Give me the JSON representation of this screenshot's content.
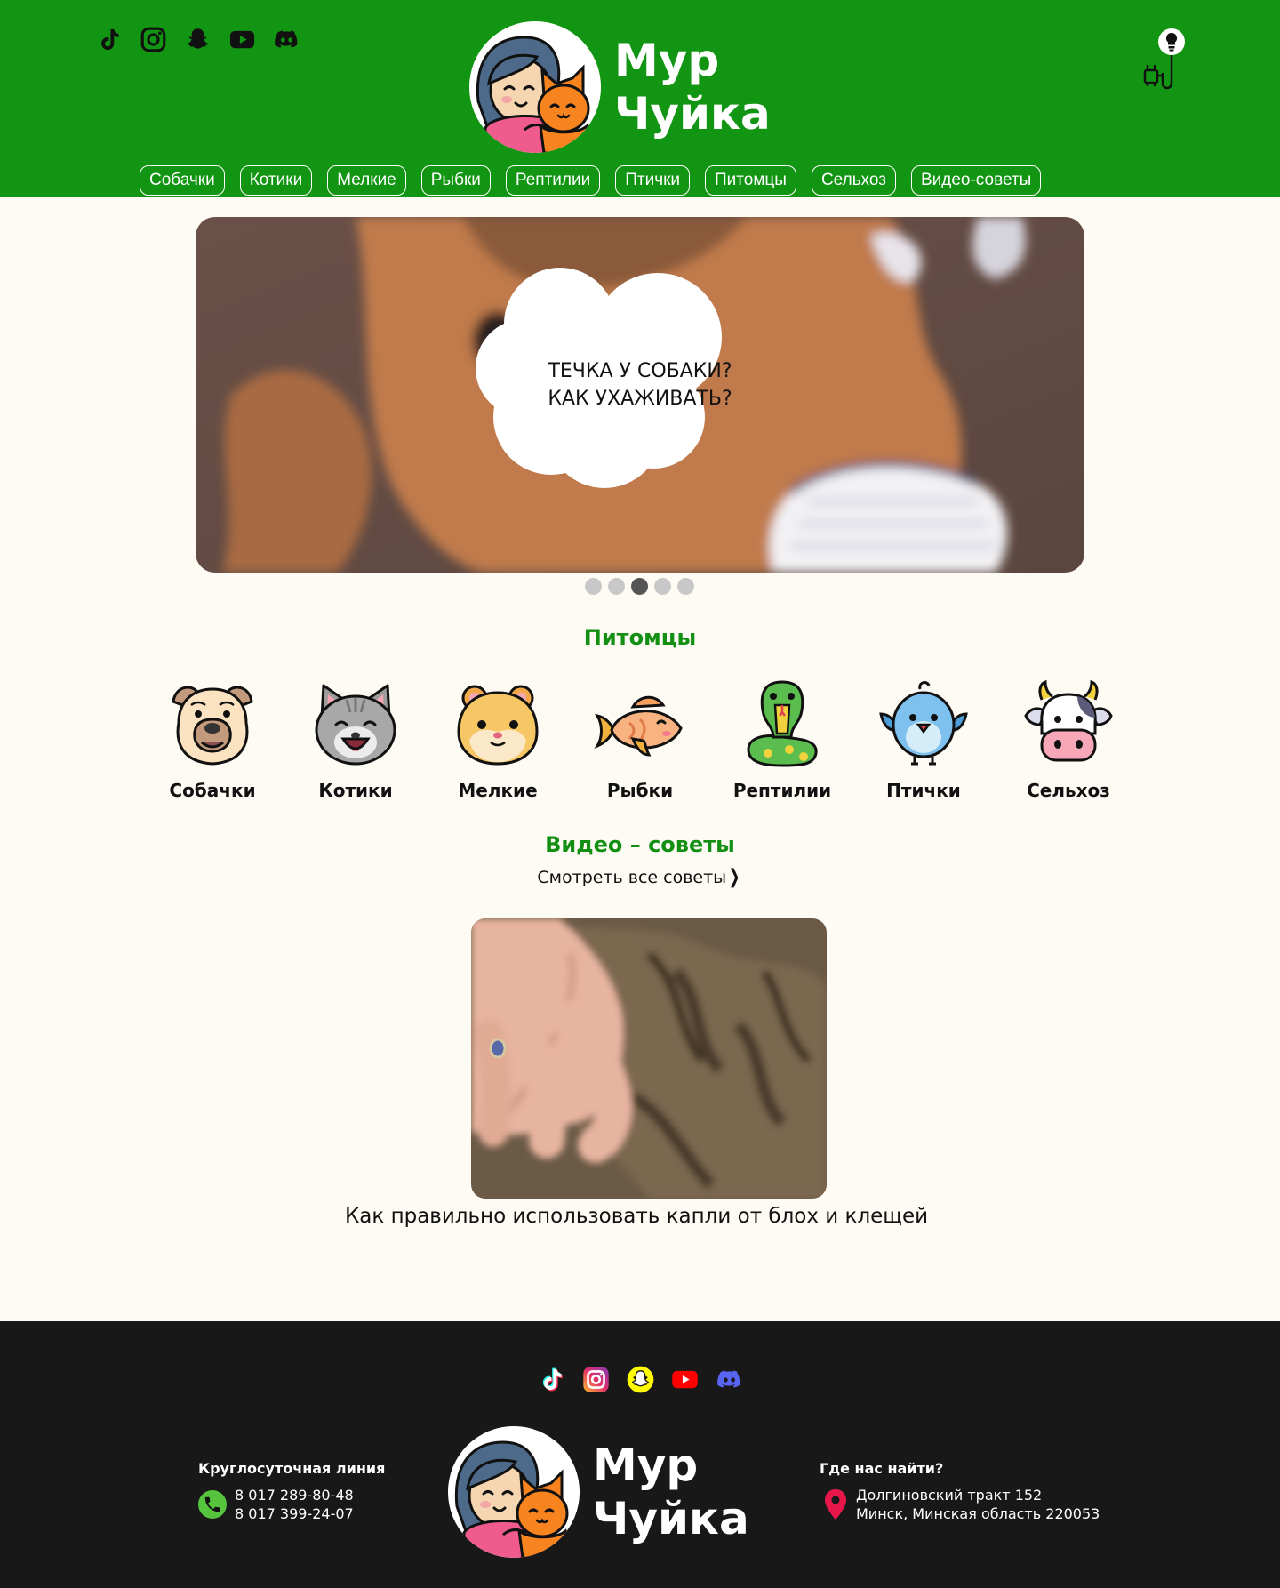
{
  "brand": {
    "name_line1": "Мур",
    "name_line2": "Чуйка"
  },
  "header": {
    "social_icons": [
      "tiktok-icon",
      "instagram-icon",
      "snapchat-icon",
      "youtube-icon",
      "discord-icon"
    ],
    "theme_toggle_icon": "lightbulb-icon",
    "colors": {
      "header_bg": "#129512",
      "accent": "#139013"
    }
  },
  "nav": {
    "items": [
      "Собачки",
      "Котики",
      "Мелкие",
      "Рыбки",
      "Рептилии",
      "Птички",
      "Питомцы",
      "Сельхоз",
      "Видео-советы"
    ]
  },
  "hero": {
    "title_line1": "ТЕЧКА У СОБАКИ?",
    "title_line2": "КАК УХАЖИВАТЬ?",
    "slides_count": 5,
    "active_slide": 3
  },
  "pets": {
    "title": "Питомцы",
    "items": [
      {
        "label": "Собачки",
        "icon": "bulldog-icon"
      },
      {
        "label": "Котики",
        "icon": "cat-icon"
      },
      {
        "label": "Мелкие",
        "icon": "hamster-icon"
      },
      {
        "label": "Рыбки",
        "icon": "fish-icon"
      },
      {
        "label": "Рептилии",
        "icon": "snake-icon"
      },
      {
        "label": "Птички",
        "icon": "bird-icon"
      },
      {
        "label": "Сельхоз",
        "icon": "cow-icon"
      }
    ]
  },
  "videos": {
    "title": "Видео – советы",
    "all_link": "Смотреть все советы",
    "items": [
      {
        "caption": "Как правильно использовать капли от блох и клещей"
      }
    ]
  },
  "footer": {
    "social_icons": [
      "tiktok-icon",
      "instagram-icon",
      "snapchat-icon",
      "youtube-icon",
      "discord-icon"
    ],
    "hotline_title": "Круглосуточная линия",
    "phones": [
      "8 017 289-80-48",
      "8 017 399-24-07"
    ],
    "address_title": "Где нас найти?",
    "address_lines": [
      "Долгиновский тракт 152",
      "Минск, Минская область 220053"
    ],
    "colors": {
      "footer_bg": "#181818"
    }
  }
}
